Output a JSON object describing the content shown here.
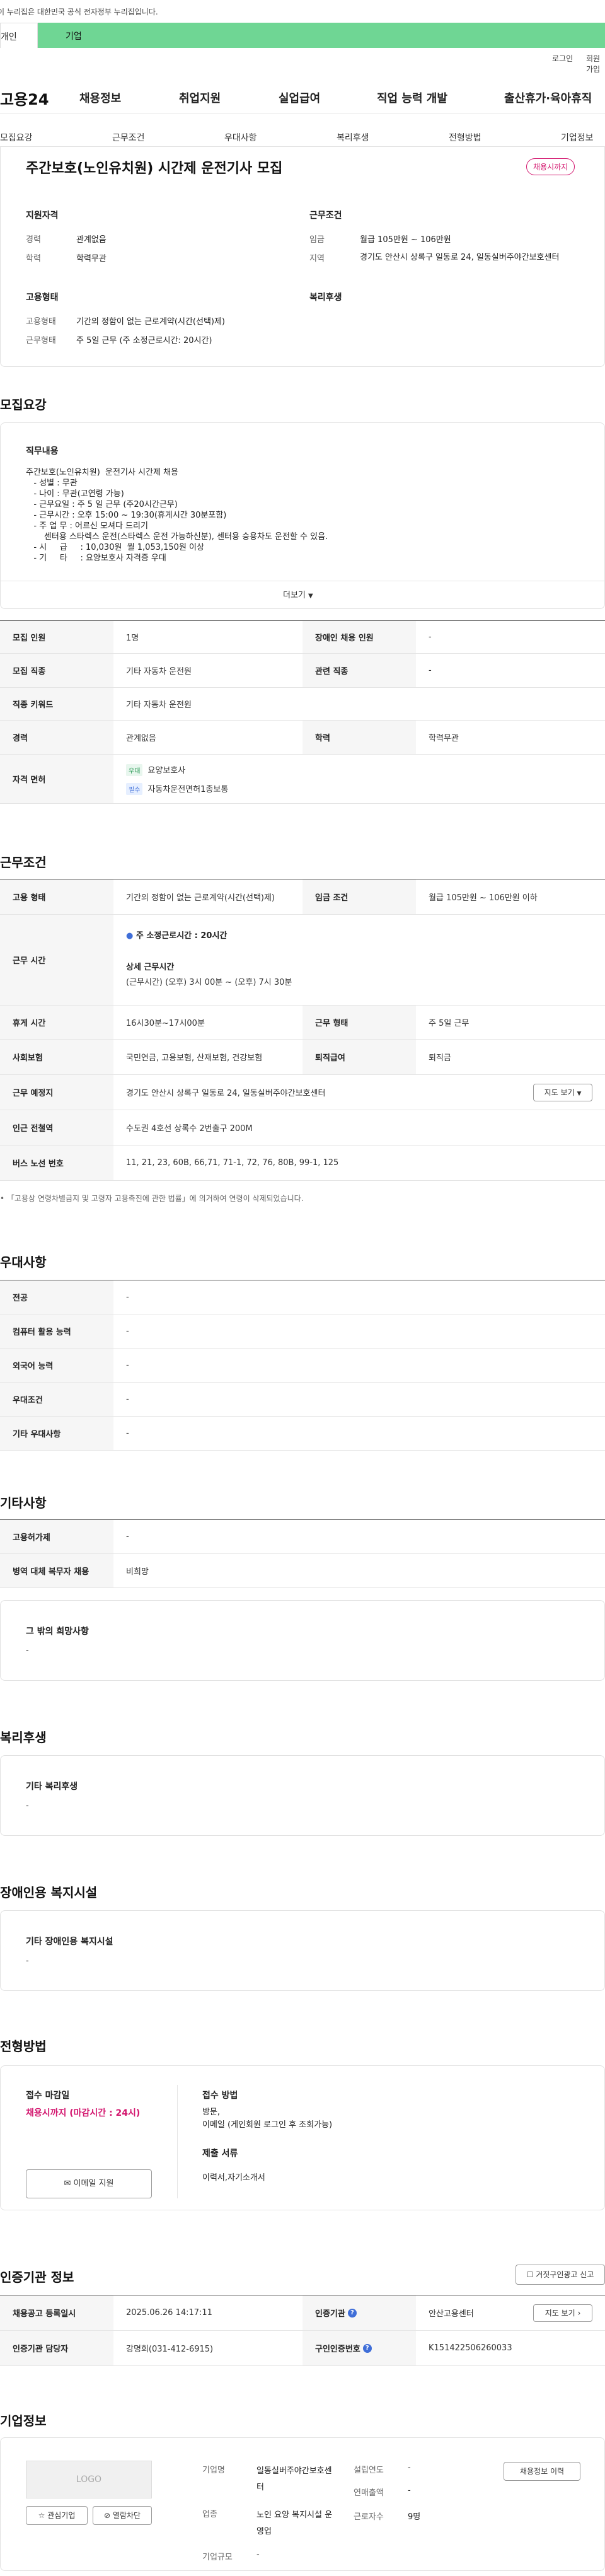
{
  "gov_notice": "이 누리집은 대한민국 공식 전자정부 누리집입니다.",
  "top_tabs": {
    "personal": "개인",
    "corporate": "기업"
  },
  "util": {
    "login": "로그인",
    "join": "회원가입"
  },
  "gnb": {
    "logo": "고용24",
    "menu": [
      "채용정보",
      "취업지원",
      "실업급여",
      "직업 능력 개발",
      "출산휴가·육아휴직"
    ]
  },
  "subnav": [
    "모집요강",
    "근무조건",
    "우대사항",
    "복리후생",
    "전형방법",
    "기업정보"
  ],
  "job": {
    "title": "주간보호(노인유치원) 시간제 운전기사 모집",
    "badge": "채용시까지",
    "qual_heading": "지원자격",
    "qual": [
      {
        "label": "경력",
        "value": "관계없음"
      },
      {
        "label": "학력",
        "value": "학력무관"
      }
    ],
    "cond_heading": "근무조건",
    "cond": [
      {
        "label": "임금",
        "value": "월급 105만원 ~ 106만원"
      },
      {
        "label": "지역",
        "value": "경기도 안산시 상록구 일동로 24, 일동실버주야간보호센터"
      }
    ],
    "emp_heading": "고용형태",
    "emp": [
      {
        "label": "고용형태",
        "value": "기간의 정함이 없는 근로계약(시간(선택)제)"
      },
      {
        "label": "근무형태",
        "value": "주 5일 근무 (주 소정근로시간: 20시간)"
      }
    ],
    "welfare_heading": "복리후생"
  },
  "recruit": {
    "heading": "모집요강",
    "duty_heading": "직무내용",
    "duty_text": "주간보호(노인유치원)  운전기사 시간제 채용\n   - 성별 : 무관\n   - 나이 : 무관(고연령 가능)\n   - 근무요일 : 주 5 일 근무 (주20시간근무)\n   - 근무시간 : 오후 15:00 ~ 19:30(휴게시간 30분포함)\n   - 주 업 무 : 어르신 모셔다 드리기\n       센터용 스타렉스 운전(스타렉스 운전 가능하신분), 센터용 승용차도 운전할 수 있음.\n   - 시     급     : 10,030원  월 1,053,150원 이상\n   - 기     타     : 요양보호사 자격증 우대",
    "more_label": "더보기",
    "rows": [
      {
        "h1": "모집 인원",
        "v1": "1명",
        "h2": "장애인 채용 인원",
        "v2": "-"
      },
      {
        "h1": "모집 직종",
        "v1": "기타 자동차 운전원",
        "h2": "관련 직종",
        "v2": "-"
      },
      {
        "h1": "직종 키워드",
        "v1": "기타 자동차 운전원"
      },
      {
        "h1": "경력",
        "v1": "관계없음",
        "h2": "학력",
        "v2": "학력무관"
      }
    ],
    "license_heading": "자격 면허",
    "licenses": [
      {
        "tag": "우대",
        "name": "요양보호사"
      },
      {
        "tag": "필수",
        "name": "자동차운전면허1종보통"
      }
    ]
  },
  "work": {
    "heading": "근무조건",
    "emp_type_h": "고용 형태",
    "emp_type_v": "기간의 정함이 없는 근로계약(시간(선택)제)",
    "wage_h": "임금 조건",
    "wage_v": "월급 105만원 ~ 106만원 이하",
    "hours_h": "근무 시간",
    "hours_weekly": "주 소정근로시간 : 20시간",
    "hours_detail_h": "상세 근무시간",
    "hours_detail_v": "(근무시간) (오후) 3시 00분 ~ (오후) 7시 30분",
    "rest_h": "휴게 시간",
    "rest_v": "16시30분~17시00분",
    "form_h": "근무 형태",
    "form_v": "주 5일 근무",
    "ins_h": "사회보험",
    "ins_v": "국민연금, 고용보험, 산재보험, 건강보험",
    "ret_h": "퇴직급여",
    "ret_v": "퇴직금",
    "place_h": "근무 예정지",
    "place_v": "경기도 안산시 상록구 일동로 24, 일동실버주야간보호센터",
    "map_btn": "지도 보기",
    "subway_h": "인근 전철역",
    "subway_v": "수도권 4호선 상록수 2번출구 200M",
    "bus_h": "버스 노선 번호",
    "bus_v": "11, 21, 23, 60B, 66,71, 71-1, 72, 76, 80B, 99-1, 125",
    "note": "「고용상 연령차별금지 및 고령자 고용촉진에 관한 법률」에 의거하여 연령이 삭제되었습니다."
  },
  "pref": {
    "heading": "우대사항",
    "rows": [
      {
        "h": "전공",
        "v": "-"
      },
      {
        "h": "컴퓨터 활용 능력",
        "v": "-"
      },
      {
        "h": "외국어 능력",
        "v": "-"
      },
      {
        "h": "우대조건",
        "v": "-"
      },
      {
        "h": "기타 우대사항",
        "v": "-"
      }
    ]
  },
  "etc": {
    "heading": "기타사항",
    "rows": [
      {
        "h": "고용허가제",
        "v": "-"
      },
      {
        "h": "병역 대체 복무자 채용",
        "v": "비희망"
      }
    ],
    "other_heading": "그 밖의 희망사항",
    "other_value": "-"
  },
  "welfare": {
    "heading": "복리후생",
    "sub": "기타 복리후생",
    "value": "-"
  },
  "disability": {
    "heading": "장애인용 복지시설",
    "sub": "기타 장애인용 복지시설",
    "value": "-"
  },
  "screening": {
    "heading": "전형방법",
    "deadline_h": "접수 마감일",
    "deadline_v": "채용시까지 (마감시간 : 24시)",
    "email_btn": "이메일 지원",
    "method_h": "접수 방법",
    "method_v1": "방문,",
    "method_v2": "이메일 (게인회원 로그인 후 조회가능)",
    "docs_h": "제출 서류",
    "docs_v": "이력서,자기소개서"
  },
  "agency": {
    "heading": "인증기관 정보",
    "report_btn": "거짓구인광고 신고",
    "reg_h": "채용공고 등록일시",
    "reg_v": "2025.06.26 14:17:11",
    "org_h": "인증기관",
    "org_v": "안산고용센터",
    "map_btn": "지도 보기",
    "mgr_h": "인증기관 담당자",
    "mgr_v": "강명희(031-412-6915)",
    "id_h": "구인인증번호",
    "id_v": "K151422506260033"
  },
  "company": {
    "heading": "기업정보",
    "logo_text": "LOGO",
    "fav_btn": "관심기업",
    "block_btn": "열람차단",
    "name_h": "기업명",
    "name_v": "일동실버주야간보호센터",
    "biz_h": "업종",
    "biz_v": "노인 요양 복지시설 운영업",
    "scale_h": "기업규모",
    "scale_v": "-",
    "est_h": "설립연도",
    "est_v": "-",
    "sales_h": "연매출액",
    "sales_v": "-",
    "emp_h": "근로자수",
    "emp_v": "9명",
    "jobs_btn": "채용정보 이력"
  }
}
